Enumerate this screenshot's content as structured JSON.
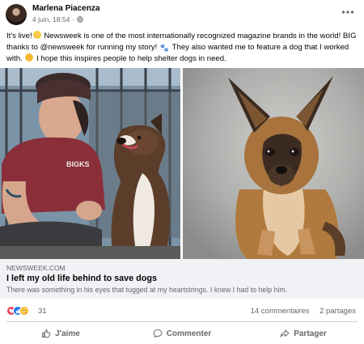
{
  "post": {
    "author": "Marlena Piacenza",
    "date": "4 juin, 18:54",
    "dot": "·",
    "more_icon": "more-dots-icon",
    "text": {
      "part1": "It's live!",
      "part2": " Newsweek is one of the most internationally recognized magazine brands in the world! BIG thanks to @newsweek for running my story! ",
      "part3": " They also wanted me to feature a dog that I worked with. ",
      "part4": " I hope this inspires people to help shelter dogs in need."
    },
    "shirt_text": "BIGKS"
  },
  "link": {
    "domain": "NEWSWEEK.COM",
    "title": "I left my old life behind to save dogs",
    "description": "There was something in his eyes that tugged at my heartstrings. I knew I had to help him."
  },
  "reactions": {
    "count": "31",
    "comments": "14 commentaires",
    "shares": "2 partages"
  },
  "actions": {
    "like": "J'aime",
    "comment": "Commenter",
    "share": "Partager"
  },
  "colors": {
    "facebook_blue": "#1877f2",
    "love_red": "#f33e58",
    "care_yellow": "#f7b125",
    "secondary_text": "#65676b",
    "preview_bg": "#f0f2f5"
  }
}
